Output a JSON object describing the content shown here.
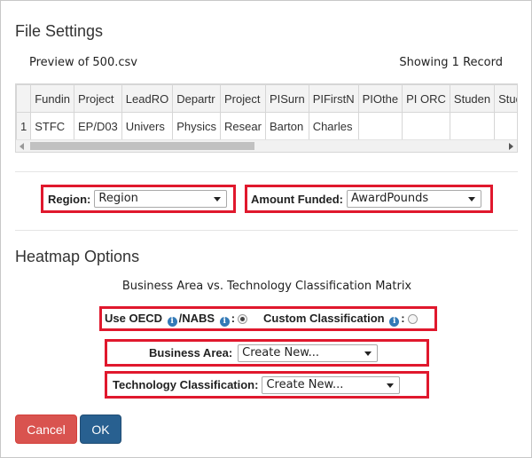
{
  "dialog": {
    "title": "File Settings"
  },
  "preview": {
    "label": "Preview of 500.csv",
    "showing": "Showing 1 Record",
    "columns": [
      "Fundin",
      "Project",
      "LeadRO",
      "Departr",
      "Project",
      "PISurn",
      "PIFirstN",
      "PIOthe",
      "PI ORC",
      "Studen",
      "Stude"
    ],
    "rows": [
      {
        "num": "1",
        "cells": [
          "STFC",
          "EP/D03",
          "Univers",
          "Physics",
          "Resear",
          "Barton",
          "Charles",
          "",
          "",
          "",
          ""
        ]
      }
    ]
  },
  "mapping": {
    "region_label": "Region:",
    "region_value": "Region",
    "amount_label": "Amount Funded:",
    "amount_value": "AwardPounds"
  },
  "heatmap": {
    "title": "Heatmap Options",
    "matrix_label": "Business Area vs. Technology Classification Matrix",
    "use_oecd_label_a": "Use OECD ",
    "use_oecd_label_b": "/NABS ",
    "colon": ":",
    "custom_label": "Custom Classification ",
    "use_oecd_selected": true,
    "business_area_label": "Business Area:",
    "business_area_value": "Create New...",
    "tech_label": "Technology Classification:",
    "tech_value": "Create New..."
  },
  "buttons": {
    "cancel": "Cancel",
    "ok": "OK"
  },
  "colors": {
    "highlight": "#e0182d",
    "cancel": "#d9534f",
    "ok": "#286090",
    "info": "#337ab7"
  },
  "icons": {
    "info": "info-circle-icon",
    "dropdown": "caret-down-icon"
  }
}
